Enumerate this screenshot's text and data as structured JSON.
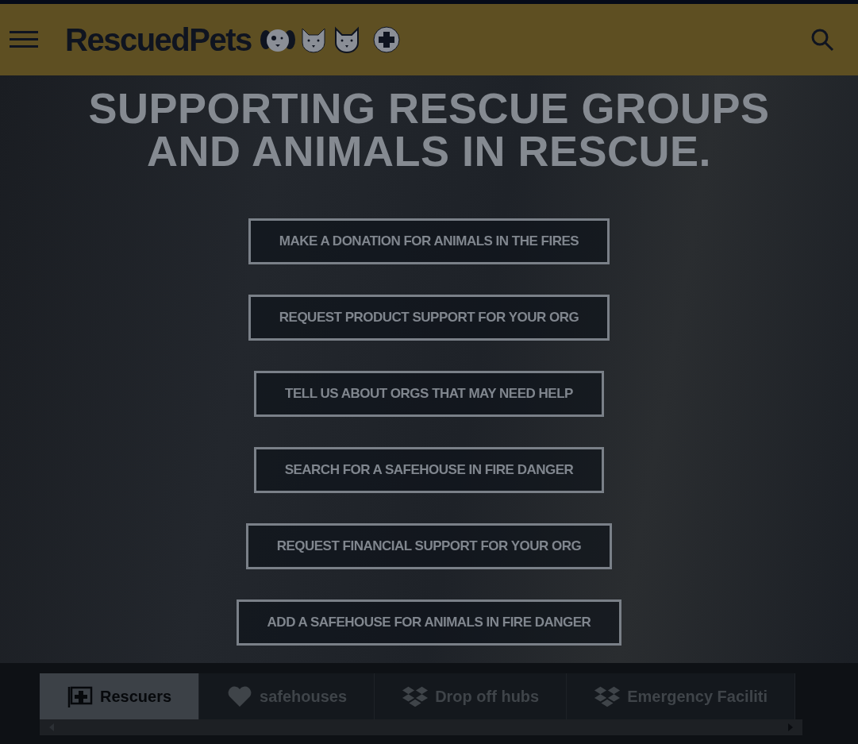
{
  "header": {
    "logo": "RescuedPets"
  },
  "hero": {
    "title_lines": [
      "SUPPORTING RESCUE GROUPS",
      "AND ANIMALS IN RESCUE."
    ],
    "buttons": [
      "MAKE A DONATION FOR ANIMALS IN THE FIRES",
      "REQUEST PRODUCT SUPPORT FOR YOUR ORG",
      "TELL US ABOUT ORGS THAT MAY NEED HELP",
      "SEARCH FOR A SAFEHOUSE IN FIRE DANGER",
      "REQUEST FINANCIAL SUPPORT FOR YOUR ORG",
      "ADD A SAFEHOUSE FOR ANIMALS IN FIRE DANGER"
    ]
  },
  "tabs": [
    {
      "label": "Rescuers",
      "kind": "medical",
      "selected": true
    },
    {
      "label": "safehouses",
      "kind": "heart",
      "selected": false
    },
    {
      "label": "Drop off hubs",
      "kind": "boxes",
      "selected": false
    },
    {
      "label": "Emergency Faciliti",
      "kind": "boxes",
      "selected": false
    }
  ]
}
